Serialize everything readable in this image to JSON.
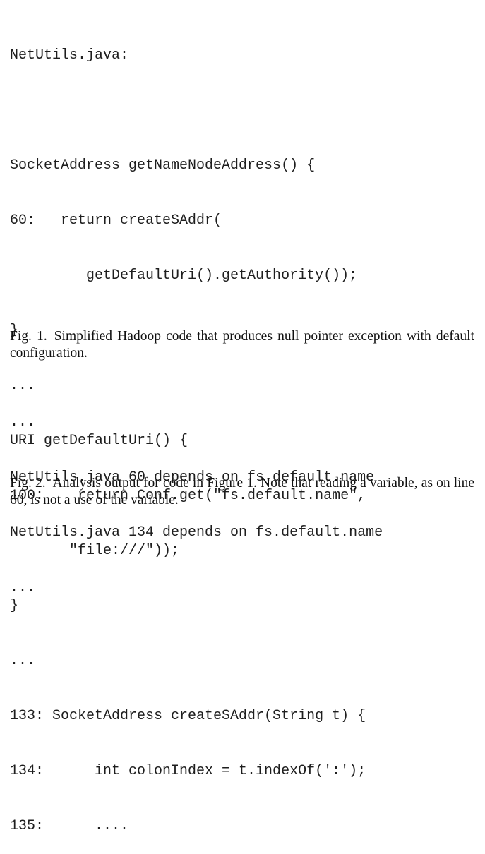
{
  "figure1": {
    "code_lines": [
      "NetUtils.java:",
      "",
      "SocketAddress getNameNodeAddress() {",
      "60:   return createSAddr(",
      "         getDefaultUri().getAuthority());",
      "}",
      "...",
      "URI getDefaultUri() {",
      "100:    return Conf.get(\"fs.default.name\",",
      "       \"file:///\"));",
      "}",
      "...",
      "133: SocketAddress createSAddr(String t) {",
      "134:      int colonIndex = t.indexOf(':');",
      "135:      ...."
    ],
    "caption_label": "Fig. 1.",
    "caption_text": "Simplified Hadoop code that produces null pointer exception with default configuration."
  },
  "figure2": {
    "code_lines": [
      "...",
      "NetUtils.java 60 depends on fs.default.name",
      "NetUtils.java 134 depends on fs.default.name",
      "..."
    ],
    "caption_label": "Fig. 2.",
    "caption_text": "Analysis output for code in Figure 1. Note that reading a variable, as on line 60, is not a use of the variable."
  }
}
